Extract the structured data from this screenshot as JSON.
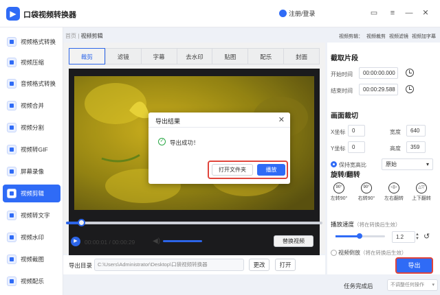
{
  "app": {
    "title": "口袋视频转换器",
    "login": "注册/登录"
  },
  "sidebar": {
    "items": [
      {
        "label": "视频格式转换"
      },
      {
        "label": "视频压缩"
      },
      {
        "label": "音频格式转换"
      },
      {
        "label": "视频合并"
      },
      {
        "label": "视频分割"
      },
      {
        "label": "视频转GIF"
      },
      {
        "label": "屏幕录像"
      },
      {
        "label": "视频剪辑",
        "active": true
      },
      {
        "label": "视频转文字"
      },
      {
        "label": "视频水印"
      },
      {
        "label": "视频截图"
      },
      {
        "label": "视频配乐"
      }
    ]
  },
  "breadcrumb": {
    "home": "首页",
    "sep": " | ",
    "current": "视频剪辑"
  },
  "help_links": [
    "视频剪辑：",
    "视频裁剪",
    "视频滤镜",
    "视频加字幕"
  ],
  "tabs": [
    "裁剪",
    "滤镜",
    "字幕",
    "去水印",
    "贴图",
    "配乐",
    "封面"
  ],
  "player": {
    "current": "00:00:01",
    "sep": " / ",
    "total": "00:00:29",
    "progress": 0.06,
    "replace_label": "替换视频"
  },
  "output": {
    "label": "导出目录",
    "path": "C:\\Users\\Administrator\\Desktop\\口袋视频转换器",
    "change": "更改",
    "open": "打开"
  },
  "panel": {
    "clip_title": "截取片段",
    "start_label": "开始时间",
    "start_value": "00:00:00.000",
    "end_label": "结束时间",
    "end_value": "00:00:29.588",
    "crop_title": "画面裁切",
    "x_label": "X坐标",
    "x_value": "0",
    "w_label": "宽度",
    "w_value": "640",
    "y_label": "Y坐标",
    "y_value": "0",
    "h_label": "高度",
    "h_value": "359",
    "ratio_label": "保持宽高比",
    "ratio_value": "原始",
    "rotate_title": "旋转/翻转",
    "rotate": [
      {
        "icon": "90°",
        "label": "左转90°"
      },
      {
        "icon": "90°",
        "label": "右转90°"
      },
      {
        "icon": "◁▷",
        "label": "左右翻转"
      },
      {
        "icon": "△▽",
        "label": "上下翻转"
      }
    ],
    "speed_title": "播放速度",
    "speed_note": "（将在转换后生效）",
    "speed_value": "1.2",
    "reverse_label": "视频倒放",
    "reverse_note": "（将在转换后生效）",
    "export_label": "导出"
  },
  "footer": {
    "after_label": "任务完成后",
    "after_value": "不调整任何操作"
  },
  "dialog": {
    "title": "导出结果",
    "message": "导出成功！",
    "open_folder": "打开文件夹",
    "play": "播放"
  },
  "colors": {
    "accent": "#2f6bf6",
    "highlight": "#e0443b",
    "success": "#29a745"
  }
}
